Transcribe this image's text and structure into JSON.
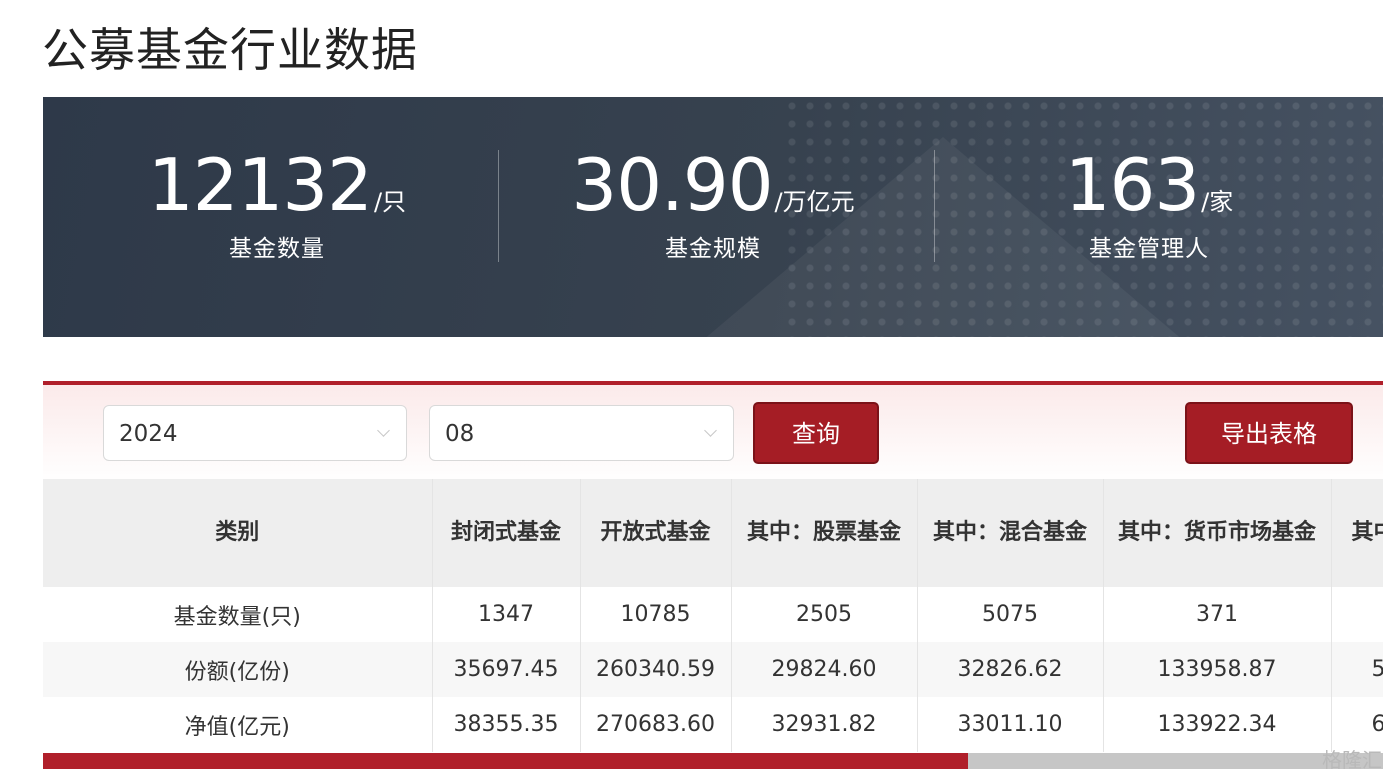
{
  "page_title": "公募基金行业数据",
  "stats": [
    {
      "value": "12132",
      "unit": "/只",
      "label": "基金数量"
    },
    {
      "value": "30.90",
      "unit": "/万亿元",
      "label": "基金规模"
    },
    {
      "value": "163",
      "unit": "/家",
      "label": "基金管理人"
    }
  ],
  "filters": {
    "year": "2024",
    "month": "08",
    "query_label": "查询",
    "export_label": "导出表格"
  },
  "table": {
    "headers": [
      "类别",
      "封闭式基金",
      "开放式基金",
      "其中：股票基金",
      "其中：混合基金",
      "其中：货币市场基金",
      "其中"
    ],
    "rows": [
      [
        "基金数量(只)",
        "1347",
        "10785",
        "2505",
        "5075",
        "371",
        ""
      ],
      [
        "份额(亿份)",
        "35697.45",
        "260340.59",
        "29824.60",
        "32826.62",
        "133958.87",
        "5"
      ],
      [
        "净值(亿元)",
        "38355.35",
        "270683.60",
        "32931.82",
        "33011.10",
        "133922.34",
        "6"
      ]
    ]
  },
  "colors": {
    "accent": "#a51d25",
    "banner": "#34404e"
  },
  "scroll_position": 0.69,
  "watermark": "格隆汇"
}
